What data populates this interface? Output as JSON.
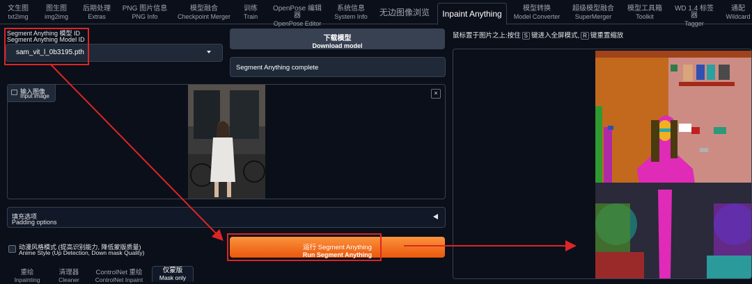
{
  "tabs": [
    {
      "l1": "文生图",
      "l2": "txt2img"
    },
    {
      "l1": "图生图",
      "l2": "img2img"
    },
    {
      "l1": "后期处理",
      "l2": "Extras"
    },
    {
      "l1": "PNG 图片信息",
      "l2": "PNG Info"
    },
    {
      "l1": "模型融合",
      "l2": "Checkpoint Merger"
    },
    {
      "l1": "训练",
      "l2": "Train"
    },
    {
      "l1": "OpenPose 编辑器",
      "l2": "OpenPose Editor"
    },
    {
      "l1": "系统信息",
      "l2": "System Info"
    },
    {
      "single": "无边图像浏览"
    },
    {
      "single": "Inpaint Anything"
    },
    {
      "l1": "模型转换",
      "l2": "Model Converter"
    },
    {
      "l1": "超级模型融合",
      "l2": "SuperMerger"
    },
    {
      "l1": "模型工具箱",
      "l2": "Toolkit"
    },
    {
      "l1": "WD 1.4 标签器",
      "l2": "Tagger"
    },
    {
      "l1": "通配",
      "l2": "Wildcard"
    }
  ],
  "model": {
    "label_cn": "Segment Anything 模型 ID",
    "label_en": "Segment Anything Model ID",
    "value": "sam_vit_l_0b3195.pth"
  },
  "download": {
    "cn": "下载模型",
    "en": "Download model"
  },
  "status": "Segment Anything complete",
  "input_image": {
    "cn": "输入图像",
    "en": "Input image",
    "close": "×"
  },
  "padding": {
    "cn": "填充选项",
    "en": "Padding options"
  },
  "anime": {
    "cn": "动漫风格模式 (提高识别能力, 降低蒙版质量)",
    "en": "Anime Style (Up Detection, Down mask Quality)"
  },
  "run": {
    "cn": "运行 Segment Anything",
    "en": "Run Segment Anything"
  },
  "subtabs": [
    {
      "l1": "重绘",
      "l2": "Inpainting"
    },
    {
      "l1": "清理器",
      "l2": "Cleaner"
    },
    {
      "l1": "ControlNet 重绘",
      "l2": "ControlNet Inpaint"
    },
    {
      "l1": "仅蒙版",
      "l2": "Mask only"
    }
  ],
  "hint": {
    "a": "鼠标置于图片之上:按住",
    "k1": "S",
    "b": "键进入全屏模式,",
    "k2": "R",
    "c": "键重置缩放"
  },
  "colors": {
    "accent": "#ea580c",
    "highlight": "#dc2626",
    "bg": "#0b0f19"
  }
}
